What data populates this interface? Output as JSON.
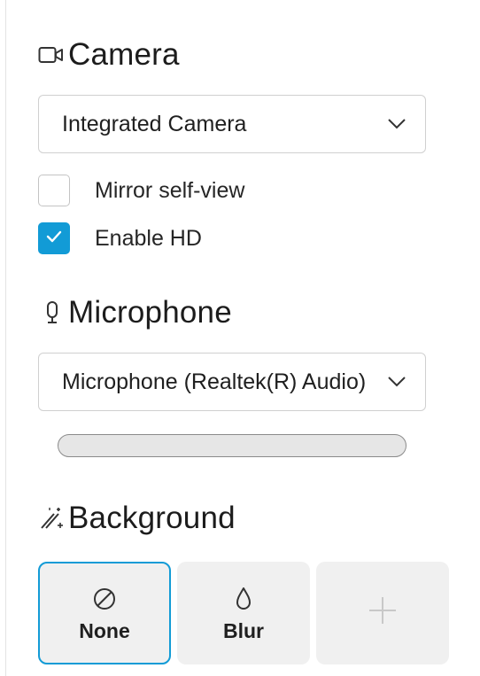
{
  "camera": {
    "title": "Camera",
    "icon": "camera-icon",
    "selected": "Integrated Camera",
    "options": [
      {
        "label": "Mirror self-view",
        "checked": false
      },
      {
        "label": "Enable HD",
        "checked": true
      }
    ]
  },
  "microphone": {
    "title": "Microphone",
    "icon": "microphone-icon",
    "selected": "Microphone (Realtek(R) Audio)",
    "level": 0
  },
  "background": {
    "title": "Background",
    "icon": "magic-wand-icon",
    "tiles": [
      {
        "label": "None",
        "icon": "none-icon",
        "selected": true
      },
      {
        "label": "Blur",
        "icon": "blur-drop-icon",
        "selected": false
      },
      {
        "label": "",
        "icon": "plus-icon",
        "selected": false
      }
    ]
  },
  "colors": {
    "accent": "#129bd6",
    "border": "#d0d0d0",
    "tile_bg": "#f0f0f0"
  }
}
